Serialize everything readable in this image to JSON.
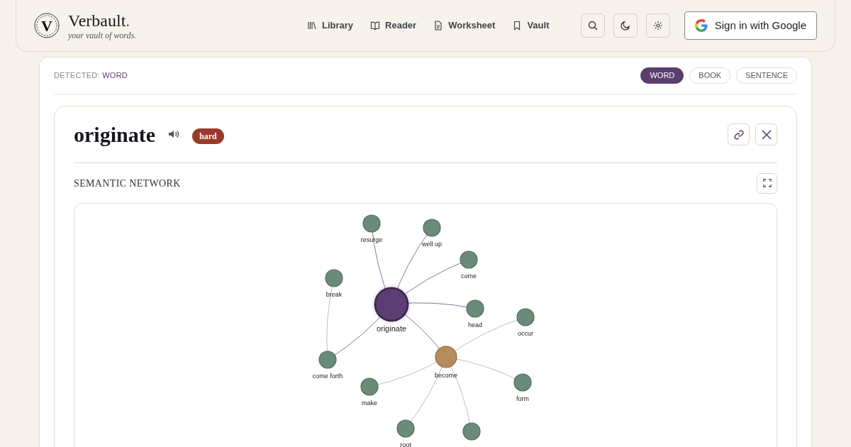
{
  "brand": {
    "name": "Verbault",
    "dot": ".",
    "tagline": "your vault of words.",
    "logo_letter": "V"
  },
  "nav": [
    {
      "label": "Library",
      "kind": "library"
    },
    {
      "label": "Reader",
      "kind": "reader"
    },
    {
      "label": "Worksheet",
      "kind": "worksheet"
    },
    {
      "label": "Vault",
      "kind": "vault"
    }
  ],
  "sign_in": {
    "label": "Sign in with Google"
  },
  "detected": {
    "label": "DETECTED:",
    "value": "WORD"
  },
  "modes": [
    {
      "label": "WORD",
      "selected": true
    },
    {
      "label": "BOOK",
      "selected": false
    },
    {
      "label": "SENTENCE",
      "selected": false
    }
  ],
  "word": {
    "text": "originate",
    "difficulty": "hard"
  },
  "network": {
    "title": "SEMANTIC NETWORK",
    "root": {
      "label": "originate",
      "kind": "center",
      "children": [
        {
          "label": "resurge",
          "kind": "leaf"
        },
        {
          "label": "well up",
          "kind": "leaf"
        },
        {
          "label": "come",
          "kind": "leaf"
        },
        {
          "label": "head",
          "kind": "leaf"
        },
        {
          "label": "come forth",
          "kind": "leaf",
          "children": [
            {
              "label": "break",
              "kind": "leaf"
            }
          ]
        },
        {
          "label": "become",
          "kind": "hub",
          "children": [
            {
              "label": "occur",
              "kind": "leaf"
            },
            {
              "label": "form",
              "kind": "leaf"
            },
            {
              "kind": "leaf"
            },
            {
              "label": "root",
              "kind": "leaf"
            },
            {
              "label": "make",
              "kind": "leaf"
            }
          ]
        }
      ]
    }
  }
}
